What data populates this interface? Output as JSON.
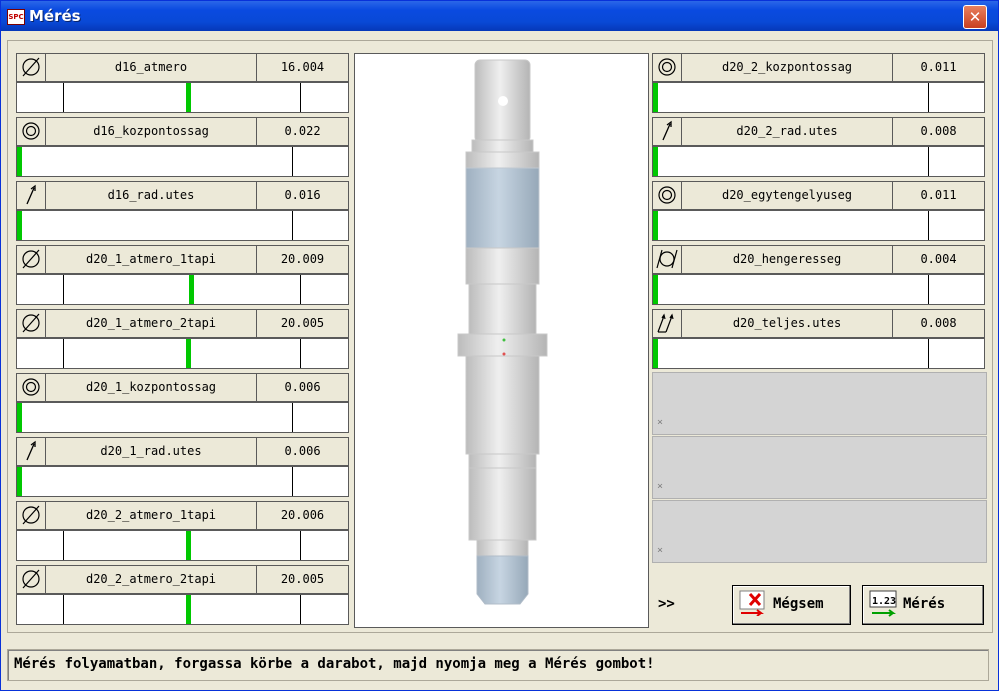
{
  "window": {
    "title": "Mérés",
    "app_icon": "SPC"
  },
  "left_measurements": [
    {
      "icon": "diameter-icon",
      "name": "d16_atmero",
      "value": "16.004",
      "scale": "three-tick",
      "level": 0.51
    },
    {
      "icon": "concentricity-icon",
      "name": "d16_kozpontossag",
      "value": "0.022",
      "scale": "zero-limit",
      "level": 0.0
    },
    {
      "icon": "runout-icon",
      "name": "d16_rad.utes",
      "value": "0.016",
      "scale": "zero-limit",
      "level": 0.0
    },
    {
      "icon": "diameter-icon",
      "name": "d20_1_atmero_1tapi",
      "value": "20.009",
      "scale": "three-tick",
      "level": 0.52
    },
    {
      "icon": "diameter-icon",
      "name": "d20_1_atmero_2tapi",
      "value": "20.005",
      "scale": "three-tick",
      "level": 0.51
    },
    {
      "icon": "concentricity-icon",
      "name": "d20_1_kozpontossag",
      "value": "0.006",
      "scale": "zero-limit",
      "level": 0.0
    },
    {
      "icon": "runout-icon",
      "name": "d20_1_rad.utes",
      "value": "0.006",
      "scale": "zero-limit",
      "level": 0.0
    },
    {
      "icon": "diameter-icon",
      "name": "d20_2_atmero_1tapi",
      "value": "20.006",
      "scale": "three-tick",
      "level": 0.51
    },
    {
      "icon": "diameter-icon",
      "name": "d20_2_atmero_2tapi",
      "value": "20.005",
      "scale": "three-tick",
      "level": 0.51
    }
  ],
  "right_measurements": [
    {
      "icon": "concentricity-icon",
      "name": "d20_2_kozpontossag",
      "value": "0.011",
      "scale": "zero-limit",
      "level": 0.0
    },
    {
      "icon": "runout-icon",
      "name": "d20_2_rad.utes",
      "value": "0.008",
      "scale": "zero-limit",
      "level": 0.0
    },
    {
      "icon": "concentricity-icon",
      "name": "d20_egytengelyuseg",
      "value": "0.011",
      "scale": "zero-limit",
      "level": 0.0
    },
    {
      "icon": "cylindricity-icon",
      "name": "d20_hengeresseg",
      "value": "0.004",
      "scale": "zero-limit",
      "level": 0.0
    },
    {
      "icon": "total-runout-icon",
      "name": "d20_teljes.utes",
      "value": "0.008",
      "scale": "zero-limit",
      "level": 0.0
    }
  ],
  "empty_slots": [
    {
      "mark": "×"
    },
    {
      "mark": "×"
    },
    {
      "mark": "×"
    }
  ],
  "footer": {
    "more_label": ">>",
    "cancel_label": "Mégsem",
    "measure_label": "Mérés",
    "measure_icon_text": "1.23"
  },
  "status": {
    "text": "Mérés folyamatban, forgassa körbe a darabot, majd nyomja meg a Mérés gombot!"
  },
  "colors": {
    "ok_indicator": "#00c800",
    "title_bar": "#0a4ae0",
    "part_body": "#d6d6d6",
    "part_highlight": "#b7c7d6"
  }
}
